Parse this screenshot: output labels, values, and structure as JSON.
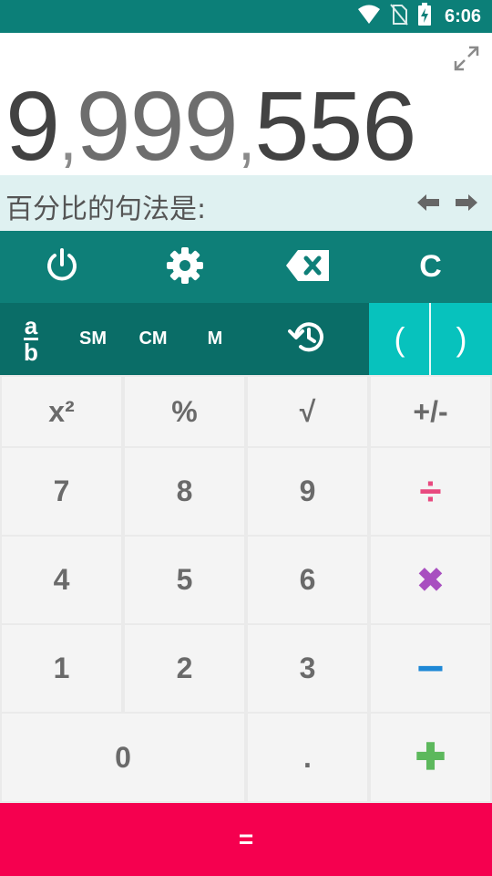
{
  "status_bar": {
    "time": "6:06",
    "icons": [
      "wifi-icon",
      "no-sim-icon",
      "battery-charging-icon"
    ]
  },
  "display": {
    "groups": [
      "9",
      ",",
      "999",
      ",",
      "556"
    ],
    "icon": "expand-icon"
  },
  "hint_bar": {
    "text": "百分比的句法是:",
    "icons": [
      "arrow-left-icon",
      "arrow-right-icon"
    ]
  },
  "toolbar": {
    "icons": [
      "power-icon",
      "gear-icon",
      "backspace-icon"
    ],
    "clear_label": "C"
  },
  "memory_row": {
    "fraction_top": "a",
    "fraction_bottom": "b",
    "sm_label": "SM",
    "cm_label": "CM",
    "m_label": "M",
    "history_icon": "history-icon",
    "open_paren": "(",
    "close_paren": ")"
  },
  "keys": {
    "square": "x²",
    "percent": "%",
    "sqrt": "√",
    "plus_minus": "+/-",
    "seven": "7",
    "eight": "8",
    "nine": "9",
    "divide": "÷",
    "four": "4",
    "five": "5",
    "six": "6",
    "multiply": "✖",
    "one": "1",
    "two": "2",
    "three": "3",
    "minus": "−",
    "zero": "0",
    "decimal": ".",
    "plus": "✚"
  },
  "equals_label": "=",
  "colors": {
    "teal_dark": "#0c7f78",
    "teal_accent": "#07c2bd",
    "pink_equals": "#f5004f",
    "divide": "#e84a7f",
    "multiply": "#a84fc0",
    "minus": "#1e88d6",
    "plus": "#5cb85c"
  }
}
